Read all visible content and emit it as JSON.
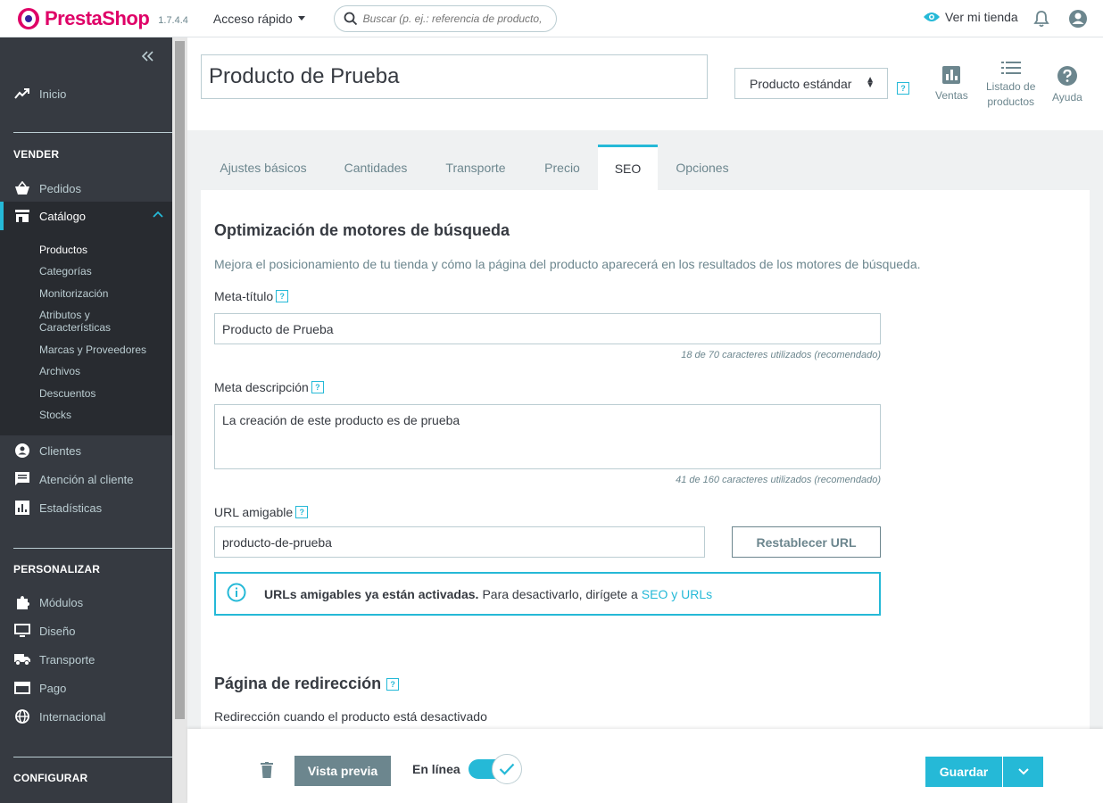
{
  "header": {
    "brand": "PrestaShop",
    "version": "1.7.4.4",
    "quick_access": "Acceso rápido",
    "search_placeholder": "Buscar (p. ej.: referencia de producto, nombre de cliente...)",
    "view_store": "Ver mi tienda"
  },
  "sidebar": {
    "home": "Inicio",
    "sections": {
      "sell": "VENDER",
      "customize": "PERSONALIZAR",
      "configure": "CONFIGURAR"
    },
    "sell_items": [
      "Pedidos",
      "Catálogo"
    ],
    "catalog_sub": [
      "Productos",
      "Categorías",
      "Monitorización",
      "Atributos y Características",
      "Marcas y Proveedores",
      "Archivos",
      "Descuentos",
      "Stocks"
    ],
    "after_items": [
      "Clientes",
      "Atención al cliente",
      "Estadísticas"
    ],
    "customize_items": [
      "Módulos",
      "Diseño",
      "Transporte",
      "Pago",
      "Internacional"
    ]
  },
  "product": {
    "name": "Producto de Prueba",
    "type": "Producto estándar",
    "toolbar": {
      "sales": "Ventas",
      "list_line1": "Listado de",
      "list_line2": "productos",
      "help": "Ayuda"
    }
  },
  "tabs": [
    "Ajustes básicos",
    "Cantidades",
    "Transporte",
    "Precio",
    "SEO",
    "Opciones"
  ],
  "seo": {
    "title": "Optimización de motores de búsqueda",
    "lead": "Mejora el posicionamiento de tu tienda y cómo la página del producto aparecerá en los resultados de los motores de búsqueda.",
    "meta_title_label": "Meta-título",
    "meta_title_value": "Producto de Prueba",
    "meta_title_counter": "18 de 70 caracteres utilizados (recomendado)",
    "meta_desc_label": "Meta descripción",
    "meta_desc_value": "La creación de este producto es de prueba",
    "meta_desc_counter": "41 de 160 caracteres utilizados (recomendado)",
    "url_label": "URL amigable",
    "url_value": "producto-de-prueba",
    "reset_url": "Restablecer URL",
    "alert_bold": "URLs amigables ya están activadas.",
    "alert_text": "Para desactivarlo, dirígete a",
    "alert_link": "SEO y URLs",
    "redirect_title": "Página de redirección",
    "redirect_desc": "Redirección cuando el producto está desactivado"
  },
  "footer": {
    "preview": "Vista previa",
    "online": "En línea",
    "save": "Guardar"
  },
  "colors": {
    "accent": "#25b9d7",
    "sidebar": "#363a41",
    "brand": "#df0067"
  }
}
